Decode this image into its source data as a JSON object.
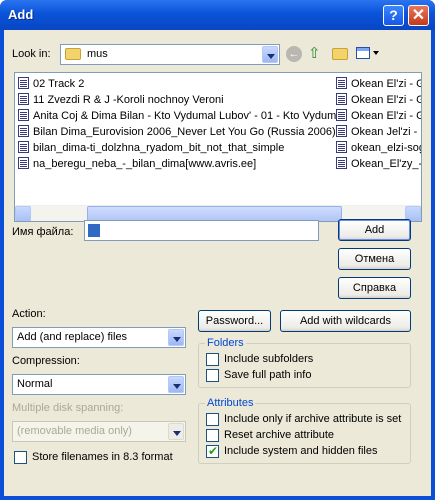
{
  "window": {
    "title": "Add",
    "help_label": "?",
    "close_label": "✕"
  },
  "look_in": {
    "label": "Look in:",
    "value": "mus"
  },
  "files": {
    "col1": [
      "02 Track 2",
      "11 Zvezdi R & J -Koroli nochnoy Veroni",
      "Anita Coj & Dima Bilan - Kto Vydumal Lubov' - 01 - Kto Vydum",
      "Bilan Dima_Eurovision 2006_Never Let You Go (Russia 2006)",
      "bilan_dima-ti_dolzhna_ryadom_bit_not_that_simple",
      "na_beregu_neba_-_bilan_dima[www.avris.ee]"
    ],
    "col2": [
      "Okean El'zi - G",
      "Okean El'zi - G",
      "Okean El'zi - G",
      "Okean Jel'zi - I",
      "okean_elzi-sog",
      "Okean_El'zy_-"
    ]
  },
  "filename": {
    "label": "Имя файла:",
    "value": ""
  },
  "buttons": {
    "add": "Add",
    "cancel": "Отмена",
    "help": "Справка",
    "password": "Password...",
    "add_wildcards": "Add with wildcards"
  },
  "action": {
    "label": "Action:",
    "value": "Add (and replace) files"
  },
  "compression": {
    "label": "Compression:",
    "value": "Normal"
  },
  "spanning": {
    "label": "Multiple disk spanning:",
    "value": "(removable media only)"
  },
  "store_filenames": {
    "label": "Store filenames in 8.3 format",
    "checked": false
  },
  "folders": {
    "title": "Folders",
    "include_subfolders": {
      "label": "Include subfolders",
      "checked": false
    },
    "save_full_path": {
      "label": "Save full path info",
      "checked": false
    }
  },
  "attributes": {
    "title": "Attributes",
    "include_archive_only": {
      "label": "Include only if archive attribute is set",
      "checked": false
    },
    "reset_archive": {
      "label": "Reset archive attribute",
      "checked": false
    },
    "include_system_hidden": {
      "label": "Include system and hidden files",
      "checked": true
    }
  }
}
